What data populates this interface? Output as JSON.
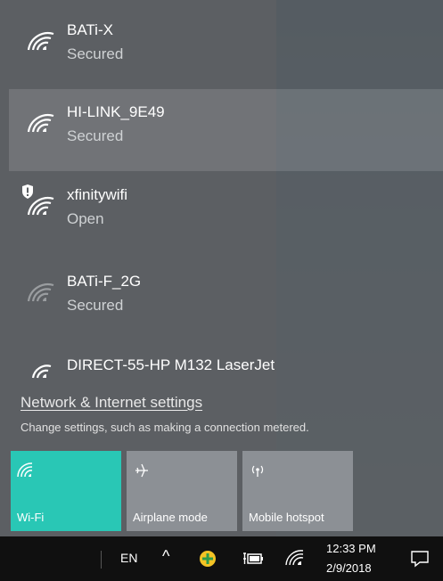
{
  "networks": [
    {
      "name": "BATi-X",
      "status": "Secured",
      "strength": "strong",
      "selected": false,
      "shield": false
    },
    {
      "name": "HI-LINK_9E49",
      "status": "Secured",
      "strength": "strong",
      "selected": true,
      "shield": false
    },
    {
      "name": "xfinitywifi",
      "status": "Open",
      "strength": "strong",
      "selected": false,
      "shield": true
    },
    {
      "name": "BATi-F_2G",
      "status": "Secured",
      "strength": "weak",
      "selected": false,
      "shield": false
    },
    {
      "name": "DIRECT-55-HP M132 LaserJet",
      "status": "",
      "strength": "medium",
      "selected": false,
      "shield": false
    }
  ],
  "settings": {
    "link": "Network & Internet settings",
    "description": "Change settings, such as making a connection metered."
  },
  "quick_actions": [
    {
      "label": "Wi-Fi",
      "icon": "wifi-icon",
      "active": true
    },
    {
      "label": "Airplane mode",
      "icon": "airplane-icon",
      "active": false
    },
    {
      "label": "Mobile hotspot",
      "icon": "hotspot-icon",
      "active": false
    }
  ],
  "taskbar": {
    "language": "EN",
    "time": "12:33 PM",
    "date": "2/9/2018"
  },
  "colors": {
    "accent": "#29c7b5",
    "tile_inactive": "#8c9095",
    "taskbar": "#101010"
  }
}
